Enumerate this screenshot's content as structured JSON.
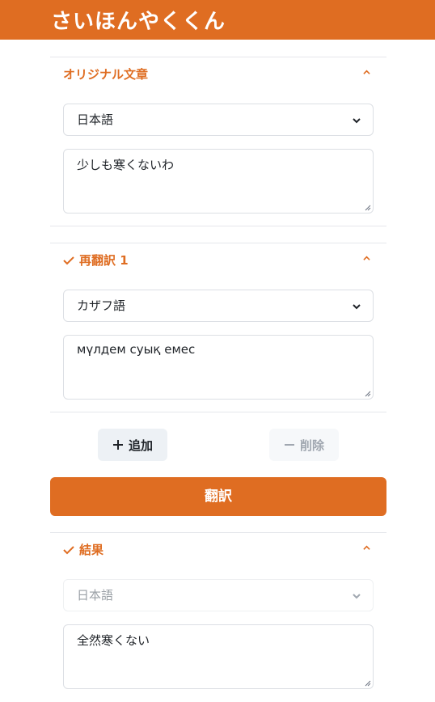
{
  "app": {
    "logo_text": "さいほんやくくん"
  },
  "original": {
    "title": "オリジナル文章",
    "language": "日本語",
    "text": "少しも寒くないわ"
  },
  "retranslation": {
    "title": "再翻訳 1",
    "language": "カザフ語",
    "text": "мүлдем суық емес"
  },
  "actions": {
    "add_label": "追加",
    "delete_label": "削除",
    "translate_label": "翻訳"
  },
  "result": {
    "title": "結果",
    "language": "日本語",
    "text": "全然寒くない"
  },
  "colors": {
    "accent": "#df6d22",
    "add_bg": "#edf1f5",
    "delete_bg": "#f6f8fa"
  }
}
